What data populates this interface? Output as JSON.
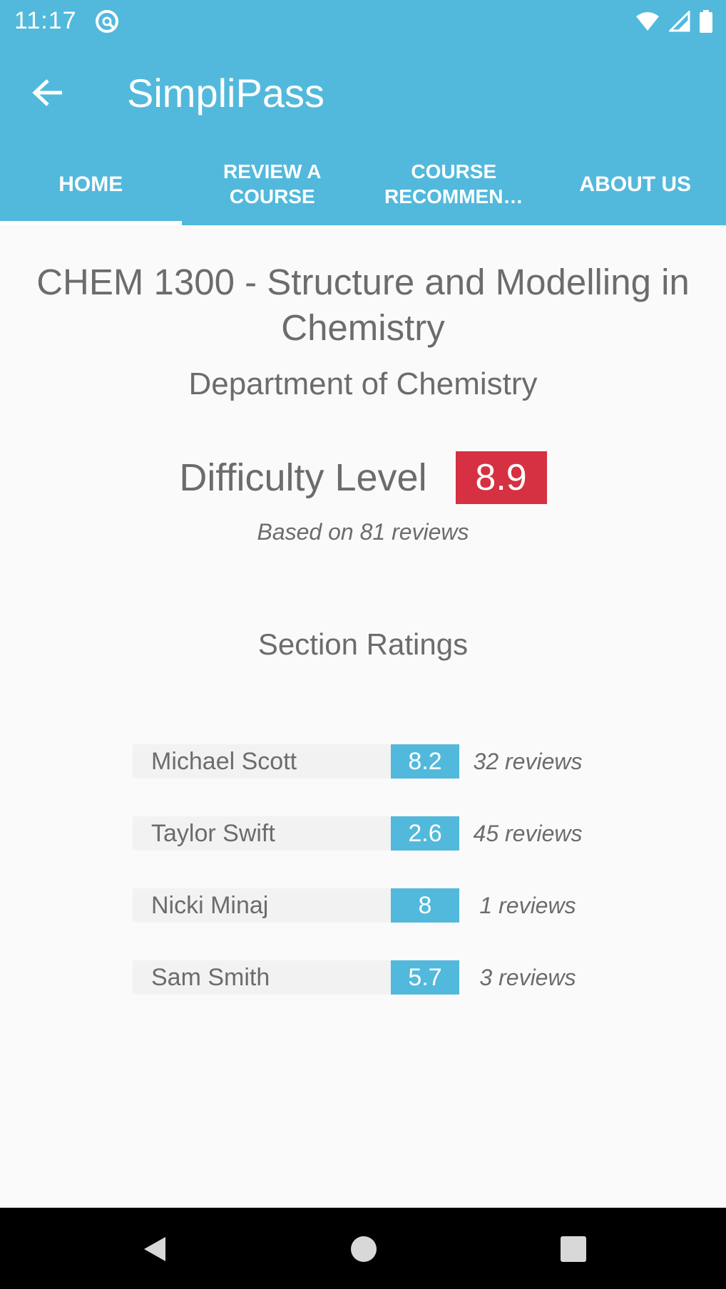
{
  "status_bar": {
    "time": "11:17",
    "icons": [
      "app-notification-icon",
      "wifi-icon",
      "cell-signal-icon",
      "battery-icon"
    ]
  },
  "app_bar": {
    "title": "SimpliPass",
    "back_icon": "arrow-left-icon"
  },
  "tabs": [
    {
      "label": "HOME",
      "active": true
    },
    {
      "label": "REVIEW A COURSE",
      "active": false
    },
    {
      "label": "COURSE RECOMMEN…",
      "active": false
    },
    {
      "label": "ABOUT US",
      "active": false
    }
  ],
  "course": {
    "title": "CHEM 1300 - Structure and Modelling in Chemistry",
    "department": "Department of Chemistry",
    "difficulty_label": "Difficulty Level",
    "difficulty_value": "8.9",
    "based_on": "Based on 81 reviews"
  },
  "section_ratings": {
    "heading": "Section Ratings",
    "rows": [
      {
        "instructor": "Michael Scott",
        "score": "8.2",
        "reviews": "32 reviews"
      },
      {
        "instructor": "Taylor Swift",
        "score": "2.6",
        "reviews": "45 reviews"
      },
      {
        "instructor": "Nicki Minaj",
        "score": "8",
        "reviews": "1 reviews"
      },
      {
        "instructor": "Sam Smith",
        "score": "5.7",
        "reviews": "3 reviews"
      }
    ]
  },
  "colors": {
    "primary": "#52b9dc",
    "difficulty_badge": "#d63142",
    "background": "#fafafa"
  },
  "nav_bar": {
    "icons": [
      "back-triangle-icon",
      "home-circle-icon",
      "recents-square-icon"
    ]
  }
}
